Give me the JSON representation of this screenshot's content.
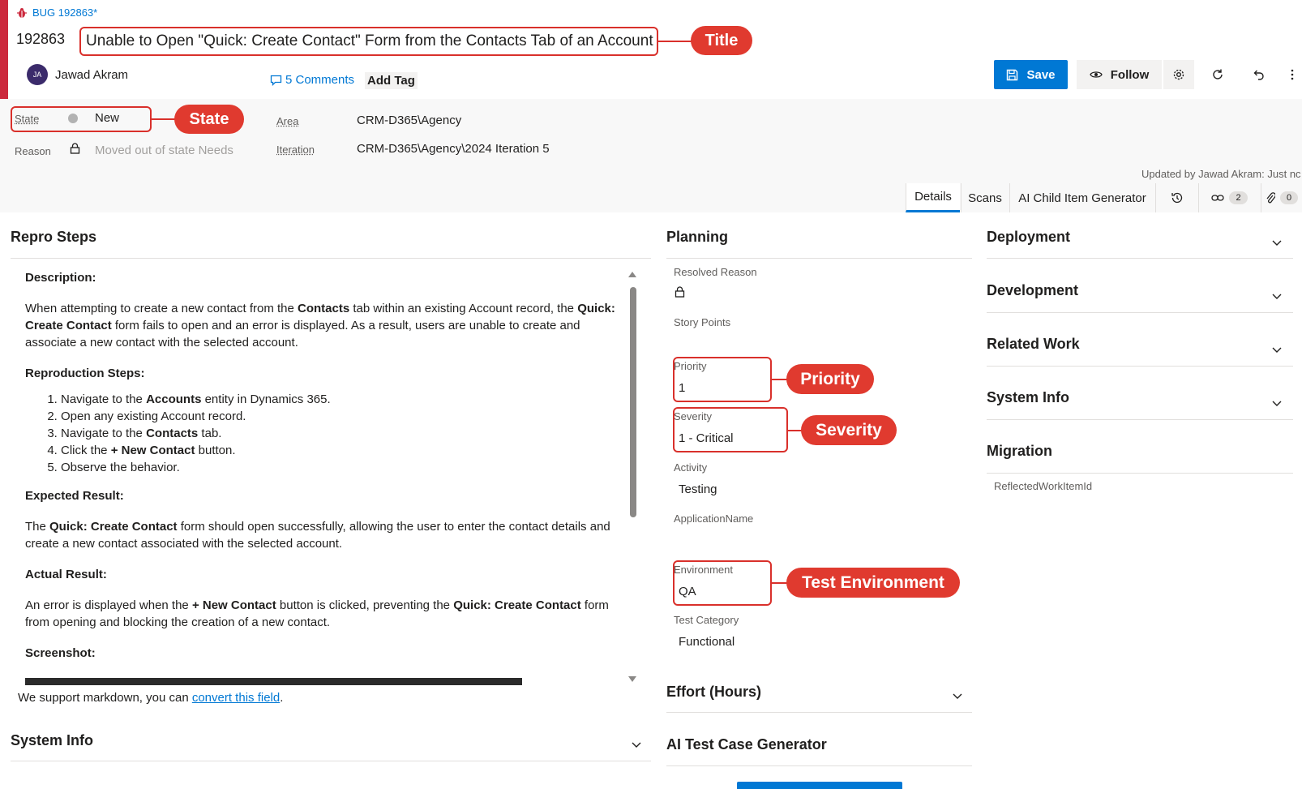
{
  "header": {
    "bug_label": "BUG 192863*",
    "id": "192863",
    "title": "Unable to Open \"Quick: Create Contact\" Form from the Contacts Tab of an Account",
    "avatar_initials": "JA",
    "user_name": "Jawad Akram",
    "comments": "5 Comments",
    "add_tag": "Add Tag",
    "save": "Save",
    "follow": "Follow",
    "updated_by": "Updated by Jawad Akram: Just nc"
  },
  "annotations": {
    "title": "Title",
    "state": "State",
    "priority": "Priority",
    "severity": "Severity",
    "environment": "Test Environment"
  },
  "fields": {
    "state_label": "State",
    "state_value": "New",
    "reason_label": "Reason",
    "reason_value": "Moved out of state Needs",
    "area_label": "Area",
    "area_value": "CRM-D365\\Agency",
    "iteration_label": "Iteration",
    "iteration_value": "CRM-D365\\Agency\\2024 Iteration 5"
  },
  "tabs": {
    "details": "Details",
    "scans": "Scans",
    "ai_child": "AI Child Item Generator",
    "links_count": "2",
    "attachments_count": "0"
  },
  "repro": {
    "title": "Repro Steps",
    "description_heading": "Description:",
    "desc_p1": "When attempting to create a new contact from the ",
    "desc_b1": "Contacts",
    "desc_p2": " tab within an existing Account record, the ",
    "desc_b2": "Quick: Create Contact",
    "desc_p3": " form fails to open and an error is displayed. As a result, users are unable to create and associate a new contact with the selected account.",
    "steps_heading": "Reproduction Steps:",
    "s1a": "Navigate to the ",
    "s1b": "Accounts",
    "s1c": " entity in Dynamics 365.",
    "s2": "Open any existing Account record.",
    "s3a": "Navigate to the ",
    "s3b": "Contacts",
    "s3c": " tab.",
    "s4a": "Click the ",
    "s4b": "+ New Contact",
    "s4c": " button.",
    "s5": "Observe the behavior.",
    "expected_heading": "Expected Result:",
    "exp_a": "The ",
    "exp_b": "Quick: Create Contact",
    "exp_c": " form should open successfully, allowing the user to enter the contact details and create a new contact associated with the selected account.",
    "actual_heading": "Actual Result:",
    "act_a": "An error is displayed when the ",
    "act_b": "+ New Contact",
    "act_c": " button is clicked, preventing the ",
    "act_d": "Quick: Create Contact",
    "act_e": " form from opening and blocking the creation of a new contact.",
    "screenshot_heading": "Screenshot:",
    "markdown_a": "We support markdown, you can ",
    "markdown_link": "convert this field",
    "markdown_b": "."
  },
  "system_info_left": "System Info",
  "planning": {
    "title": "Planning",
    "resolved_reason": "Resolved Reason",
    "story_points": "Story Points",
    "priority_label": "Priority",
    "priority_value": "1",
    "severity_label": "Severity",
    "severity_value": "1 - Critical",
    "activity_label": "Activity",
    "activity_value": "Testing",
    "application_label": "ApplicationName",
    "environment_label": "Environment",
    "environment_value": "QA",
    "test_category_label": "Test Category",
    "test_category_value": "Functional",
    "effort": "Effort (Hours)",
    "ai_test_case": "AI Test Case Generator"
  },
  "right": {
    "deployment": "Deployment",
    "development": "Development",
    "related_work": "Related Work",
    "system_info": "System Info",
    "migration": "Migration",
    "reflected": "ReflectedWorkItemId"
  },
  "colors": {
    "accent": "#0078d4",
    "bug_red": "#cc293d",
    "annotation_red": "#e03a2f"
  }
}
